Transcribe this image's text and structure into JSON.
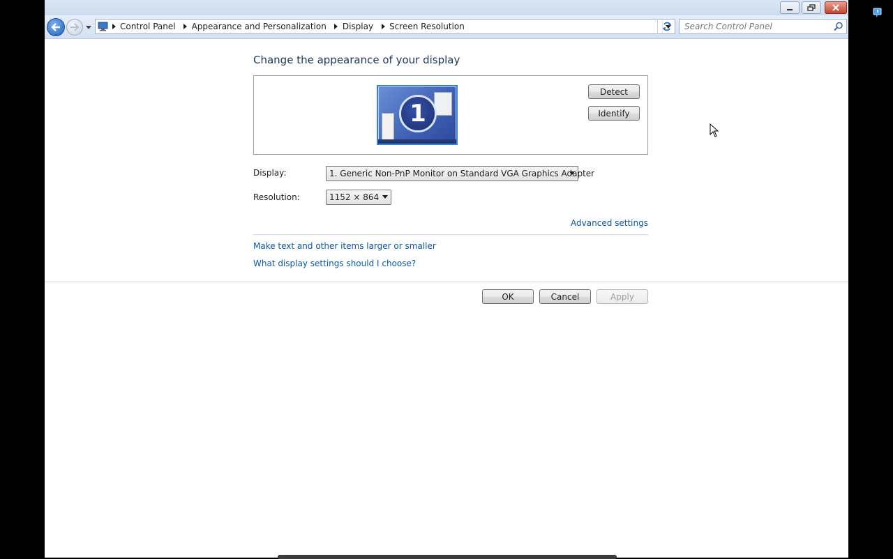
{
  "window": {
    "controls": {
      "minimize_icon": "minimize-icon",
      "maximize_icon": "restore-icon",
      "close_icon": "close-icon"
    }
  },
  "nav": {
    "back_icon": "back-arrow-icon",
    "forward_icon": "forward-arrow-icon",
    "breadcrumbs": [
      "Control Panel",
      "Appearance and Personalization",
      "Display",
      "Screen Resolution"
    ],
    "search_placeholder": "Search Control Panel"
  },
  "main": {
    "heading": "Change the appearance of your display",
    "monitor_number": "1",
    "detect_label": "Detect",
    "identify_label": "Identify",
    "display_label": "Display:",
    "display_value": "1. Generic Non-PnP Monitor on Standard VGA Graphics Adapter",
    "resolution_label": "Resolution:",
    "resolution_value": "1152 × 864",
    "advanced_link": "Advanced settings",
    "links": [
      "Make text and other items larger or smaller",
      "What display settings should I choose?"
    ]
  },
  "footer": {
    "ok_label": "OK",
    "cancel_label": "Cancel",
    "apply_label": "Apply"
  },
  "colors": {
    "heading": "#1e395b",
    "link": "#0c56a8",
    "background": "#000000"
  }
}
